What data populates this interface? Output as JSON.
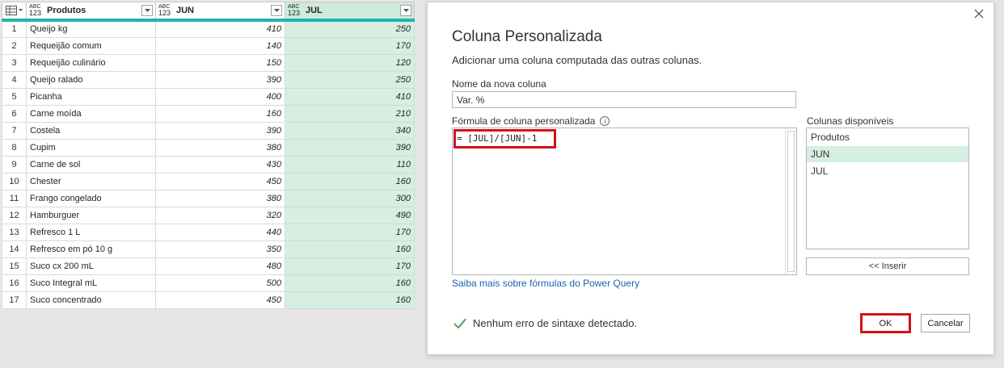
{
  "grid": {
    "columns": [
      {
        "type_top": "ABC",
        "type_bottom": "123",
        "name": "Produtos"
      },
      {
        "type_top": "ABC",
        "type_bottom": "123",
        "name": "JUN"
      },
      {
        "type_top": "ABC",
        "type_bottom": "123",
        "name": "JUL"
      }
    ],
    "rows": [
      {
        "idx": "1",
        "produto": "Queijo kg",
        "jun": "410",
        "jul": "250"
      },
      {
        "idx": "2",
        "produto": "Requeijão comum",
        "jun": "140",
        "jul": "170"
      },
      {
        "idx": "3",
        "produto": "Requeijão culinário",
        "jun": "150",
        "jul": "120"
      },
      {
        "idx": "4",
        "produto": "Queijo ralado",
        "jun": "390",
        "jul": "250"
      },
      {
        "idx": "5",
        "produto": "Picanha",
        "jun": "400",
        "jul": "410"
      },
      {
        "idx": "6",
        "produto": "Carne moída",
        "jun": "160",
        "jul": "210"
      },
      {
        "idx": "7",
        "produto": "Costela",
        "jun": "390",
        "jul": "340"
      },
      {
        "idx": "8",
        "produto": "Cupim",
        "jun": "380",
        "jul": "390"
      },
      {
        "idx": "9",
        "produto": "Carne de sol",
        "jun": "430",
        "jul": "110"
      },
      {
        "idx": "10",
        "produto": "Chester",
        "jun": "450",
        "jul": "160"
      },
      {
        "idx": "11",
        "produto": "Frango congelado",
        "jun": "380",
        "jul": "300"
      },
      {
        "idx": "12",
        "produto": "Hamburguer",
        "jun": "320",
        "jul": "490"
      },
      {
        "idx": "13",
        "produto": "Refresco 1 L",
        "jun": "440",
        "jul": "170"
      },
      {
        "idx": "14",
        "produto": "Refresco em pó 10 g",
        "jun": "350",
        "jul": "160"
      },
      {
        "idx": "15",
        "produto": "Suco cx 200 mL",
        "jun": "480",
        "jul": "170"
      },
      {
        "idx": "16",
        "produto": "Suco Integral mL",
        "jun": "500",
        "jul": "160"
      },
      {
        "idx": "17",
        "produto": "Suco concentrado",
        "jun": "450",
        "jul": "160"
      }
    ]
  },
  "dialog": {
    "title": "Coluna Personalizada",
    "subtitle": "Adicionar uma coluna computada das outras colunas.",
    "name_label": "Nome da nova coluna",
    "name_value": "Var. %",
    "formula_label": "Fórmula de coluna personalizada",
    "info_glyph": "i",
    "formula": "= [JUL]/[JUN]-1",
    "learn_more": "Saiba mais sobre fórmulas do Power Query",
    "columns_label": "Colunas disponíveis",
    "available_columns": [
      "Produtos",
      "JUN",
      "JUL"
    ],
    "selected_column": "JUN",
    "insert_label": "<< Inserir",
    "status_text": "Nenhum erro de sintaxe detectado.",
    "ok_label": "OK",
    "cancel_label": "Cancelar"
  },
  "colors": {
    "accent_teal": "#1fb5ac",
    "selected_green": "#d6efe2",
    "highlight_red": "#d3121a",
    "link_blue": "#1e62ae",
    "check_green": "#5aa86b"
  },
  "icons": [
    "table-menu-icon",
    "type-any-icon",
    "dropdown-arrow-icon",
    "close-icon",
    "info-icon",
    "checkmark-icon"
  ]
}
